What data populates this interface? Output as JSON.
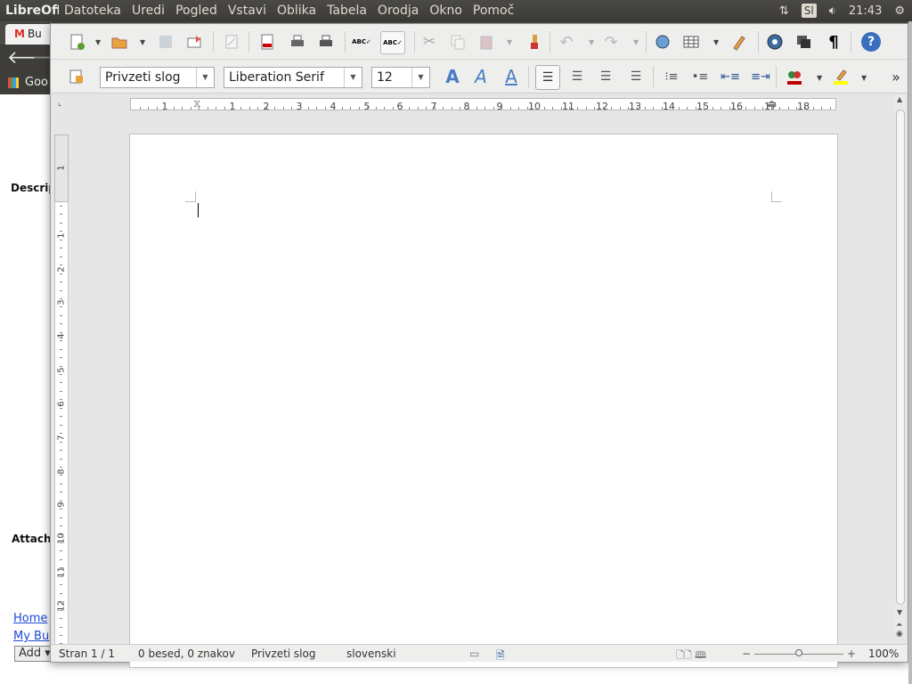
{
  "top_panel": {
    "app_name": "LibreOff",
    "menu": [
      "Datoteka",
      "Uredi",
      "Pogled",
      "Vstavi",
      "Oblika",
      "Tabela",
      "Orodja",
      "Okno",
      "Pomoč"
    ],
    "keyboard_layout": "Sl",
    "clock": "21:43"
  },
  "browser": {
    "tab_label": "Bu",
    "bookmark_label": "Goo",
    "page_text": {
      "description": "Descrip",
      "attachments": "Attachn"
    },
    "footer_links": [
      "Home",
      "My Bug"
    ],
    "add_select": "Add"
  },
  "toolbar": {
    "paragraph_style": "Privzeti slog",
    "font_name": "Liberation Serif",
    "font_size": "12",
    "pilcrow": "¶",
    "help": "?",
    "more": "»"
  },
  "ruler": {
    "h_labels": [
      "1",
      "1",
      "2",
      "3",
      "4",
      "5",
      "6",
      "7",
      "8",
      "9",
      "10",
      "11",
      "12",
      "13",
      "14",
      "15",
      "16",
      "17",
      "18"
    ],
    "v_labels": [
      "1",
      "1",
      "2",
      "3",
      "4",
      "5",
      "6",
      "7",
      "8",
      "9",
      "10",
      "11",
      "12"
    ]
  },
  "status": {
    "page": "Stran 1 / 1",
    "words": "0 besed, 0 znakov",
    "style": "Privzeti slog",
    "language": "slovenski",
    "zoom": "100%"
  },
  "colors": {
    "accent": "#2b5797",
    "panel": "#3c3b37",
    "font_color": "#c00000",
    "highlight": "#ffff00"
  }
}
